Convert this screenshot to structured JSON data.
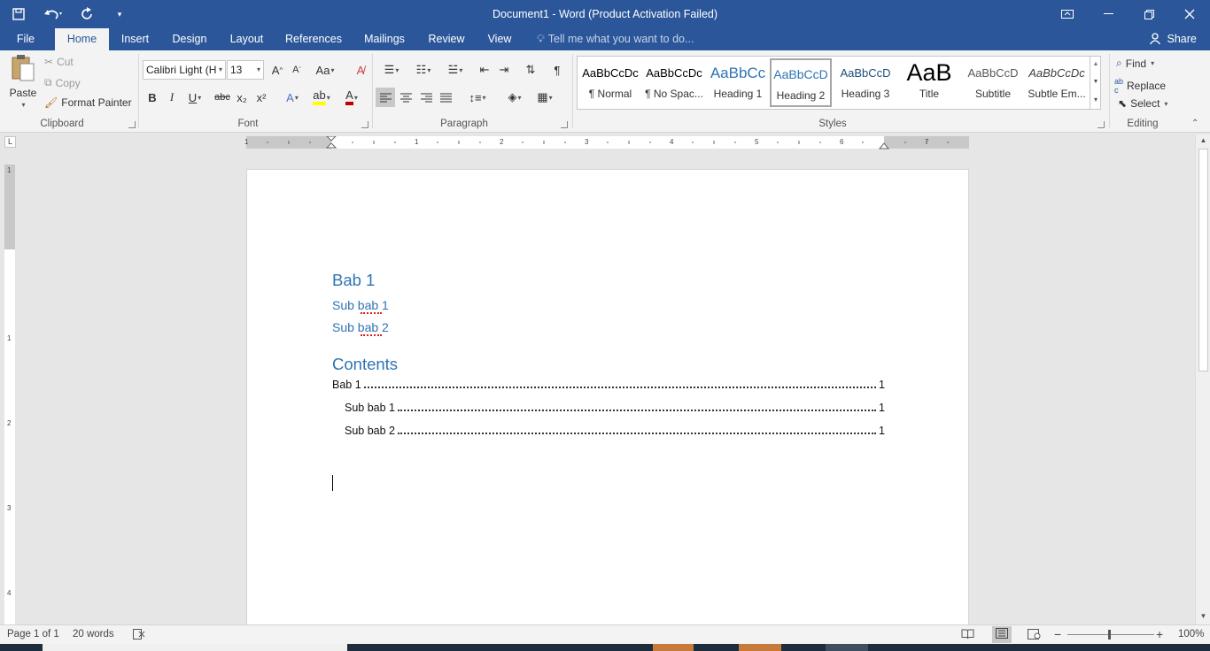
{
  "window": {
    "title": "Document1 - Word (Product Activation Failed)"
  },
  "qat": {
    "save_icon": "save-icon",
    "undo_icon": "undo-icon",
    "redo_icon": "redo-icon",
    "customize_icon": "customize-qat-icon"
  },
  "tabs": [
    {
      "label": "File"
    },
    {
      "label": "Home"
    },
    {
      "label": "Insert"
    },
    {
      "label": "Design"
    },
    {
      "label": "Layout"
    },
    {
      "label": "References"
    },
    {
      "label": "Mailings"
    },
    {
      "label": "Review"
    },
    {
      "label": "View"
    }
  ],
  "active_tab": "Home",
  "tell_me": "Tell me what you want to do...",
  "share": "Share",
  "clipboard": {
    "paste": "Paste",
    "cut": "Cut",
    "copy": "Copy",
    "format_painter": "Format Painter",
    "group_label": "Clipboard"
  },
  "font": {
    "name": "Calibri Light (H",
    "size": "13",
    "group_label": "Font",
    "bold": "B",
    "italic": "I",
    "underline": "U",
    "strikethrough": "abc",
    "subscript": "x₂",
    "superscript": "x²"
  },
  "paragraph": {
    "group_label": "Paragraph"
  },
  "styles": {
    "group_label": "Styles",
    "items": [
      {
        "preview": "AaBbCcDc",
        "name": "¶ Normal"
      },
      {
        "preview": "AaBbCcDc",
        "name": "¶ No Spac..."
      },
      {
        "preview": "AaBbCc",
        "name": "Heading 1"
      },
      {
        "preview": "AaBbCcD",
        "name": "Heading 2"
      },
      {
        "preview": "AaBbCcD",
        "name": "Heading 3"
      },
      {
        "preview": "AaB",
        "name": "Title"
      },
      {
        "preview": "AaBbCcD",
        "name": "Subtitle"
      },
      {
        "preview": "AaBbCcDc",
        "name": "Subtle Em..."
      }
    ],
    "selected": "Heading 2"
  },
  "editing": {
    "group_label": "Editing",
    "find": "Find",
    "replace": "Replace",
    "select": "Select"
  },
  "ruler": {
    "h_numbers": [
      "1",
      "1",
      "2",
      "3",
      "4",
      "5",
      "6",
      "7"
    ],
    "v_numbers": [
      "1",
      "1",
      "2",
      "3",
      "4"
    ]
  },
  "document": {
    "heading1": "Bab 1",
    "sub1": "Sub bab 1",
    "sub2": "Sub bab 2",
    "contents_title": "Contents",
    "toc": [
      {
        "text": "Bab 1",
        "page": "1",
        "level": 1
      },
      {
        "text": "Sub bab 1",
        "page": "1",
        "level": 2
      },
      {
        "text": "Sub bab 2",
        "page": "1",
        "level": 2
      }
    ]
  },
  "status": {
    "page": "Page 1 of 1",
    "words": "20 words",
    "zoom": "100%"
  },
  "colors": {
    "brand": "#2b579a",
    "heading": "#2e74b5",
    "highlight": "#ffff00",
    "font_color": "#c00000"
  }
}
